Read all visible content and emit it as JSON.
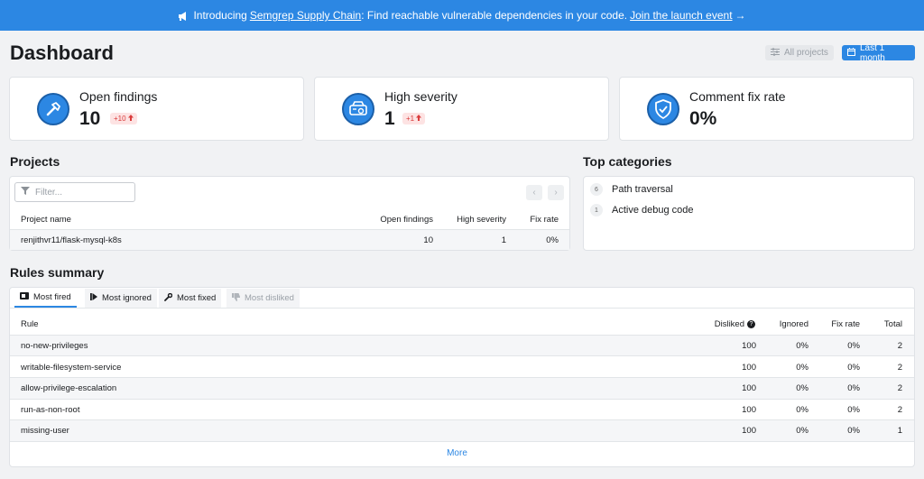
{
  "banner": {
    "prefix": "Introducing",
    "link1": "Semgrep Supply Chain",
    "middle": ": Find reachable vulnerable dependencies in your code.",
    "link2": "Join the launch event",
    "arrow": "→"
  },
  "header": {
    "title": "Dashboard",
    "projects_button": "All projects",
    "range_button": "Last 1 month"
  },
  "stats": [
    {
      "label": "Open findings",
      "value": "10",
      "delta": "+10"
    },
    {
      "label": "High severity",
      "value": "1",
      "delta": "+1"
    },
    {
      "label": "Comment fix rate",
      "value": "0%"
    }
  ],
  "projects": {
    "title": "Projects",
    "filter_placeholder": "Filter...",
    "columns": [
      "Project name",
      "Open findings",
      "High severity",
      "Fix rate"
    ],
    "rows": [
      {
        "name": "renjithvr11/flask-mysql-k8s",
        "open": "10",
        "high": "1",
        "fix": "0%"
      }
    ]
  },
  "categories": {
    "title": "Top categories",
    "items": [
      {
        "count": "6",
        "name": "Path traversal"
      },
      {
        "count": "1",
        "name": "Active debug code"
      }
    ]
  },
  "rules": {
    "title": "Rules summary",
    "tabs": [
      "Most fired",
      "Most ignored",
      "Most fixed",
      "Most disliked"
    ],
    "columns": [
      "Rule",
      "Disliked",
      "Ignored",
      "Fix rate",
      "Total"
    ],
    "rows": [
      {
        "rule": "no-new-privileges",
        "disliked": "100",
        "ignored": "0%",
        "fix": "0%",
        "total": "2"
      },
      {
        "rule": "writable-filesystem-service",
        "disliked": "100",
        "ignored": "0%",
        "fix": "0%",
        "total": "2"
      },
      {
        "rule": "allow-privilege-escalation",
        "disliked": "100",
        "ignored": "0%",
        "fix": "0%",
        "total": "2"
      },
      {
        "rule": "run-as-non-root",
        "disliked": "100",
        "ignored": "0%",
        "fix": "0%",
        "total": "2"
      },
      {
        "rule": "missing-user",
        "disliked": "100",
        "ignored": "0%",
        "fix": "0%",
        "total": "1"
      }
    ],
    "more": "More"
  },
  "colors": {
    "accent": "#2c87e3",
    "danger": "#d93b3b",
    "background": "#f1f2f4"
  }
}
